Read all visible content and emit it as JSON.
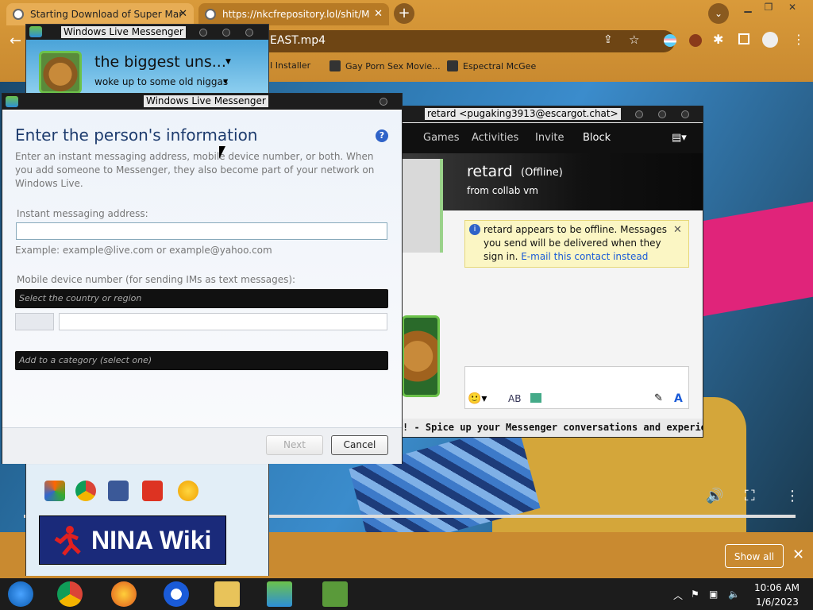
{
  "browser": {
    "tabs": [
      {
        "label": "Starting Download of Super Mar"
      },
      {
        "label": "https://nkcfrepository.lol/shit/M"
      }
    ],
    "address": "EAST.mp4",
    "bookmarks": [
      "I Installer",
      "Gay Porn Sex Movie...",
      "Espectral McGee"
    ],
    "new_tab_symbol": "+"
  },
  "downloads": {
    "show_all": "Show all",
    "close": "✕"
  },
  "wlm_main": {
    "title": "Windows Live Messenger",
    "display_name": "the biggest uns...",
    "personal_message": "woke up to some old niggas"
  },
  "dialog": {
    "title": "Windows Live Messenger",
    "heading": "Enter the person's information",
    "help": "?",
    "description": "Enter an instant messaging address, mobile device number, or both. When you add someone to Messenger, they also become part of your network on Windows Live.",
    "im_label": "Instant messaging address:",
    "im_value": "",
    "example": "Example: example@live.com or example@yahoo.com",
    "mobile_label": "Mobile device number (for sending IMs as text messages):",
    "country_placeholder": "Select the country or region",
    "category_placeholder": "Add to a category (select one)",
    "next": "Next",
    "cancel": "Cancel"
  },
  "chat": {
    "title": "retard <pugaking3913@escargot.chat>",
    "tabs": [
      "Games",
      "Activities",
      "Invite",
      "Block"
    ],
    "contact_name": "retard",
    "contact_status": "(Offline)",
    "contact_message": "from collab vm",
    "notice": "retard appears to be offline. Messages you send will be delivered when they sign in.",
    "notice_link": "E-mail this contact instead",
    "ticker": "! - Spice up your Messenger conversations and experience w..."
  },
  "nina": {
    "logo_text": "NINA Wiki"
  },
  "taskbar": {
    "time": "10:06 AM",
    "date": "1/6/2023"
  },
  "colors": {
    "chrome": "#d99a3a",
    "taskbar": "#1c1c1c",
    "dialog_title": "#1e3c6e",
    "link": "#1a5bd8"
  }
}
